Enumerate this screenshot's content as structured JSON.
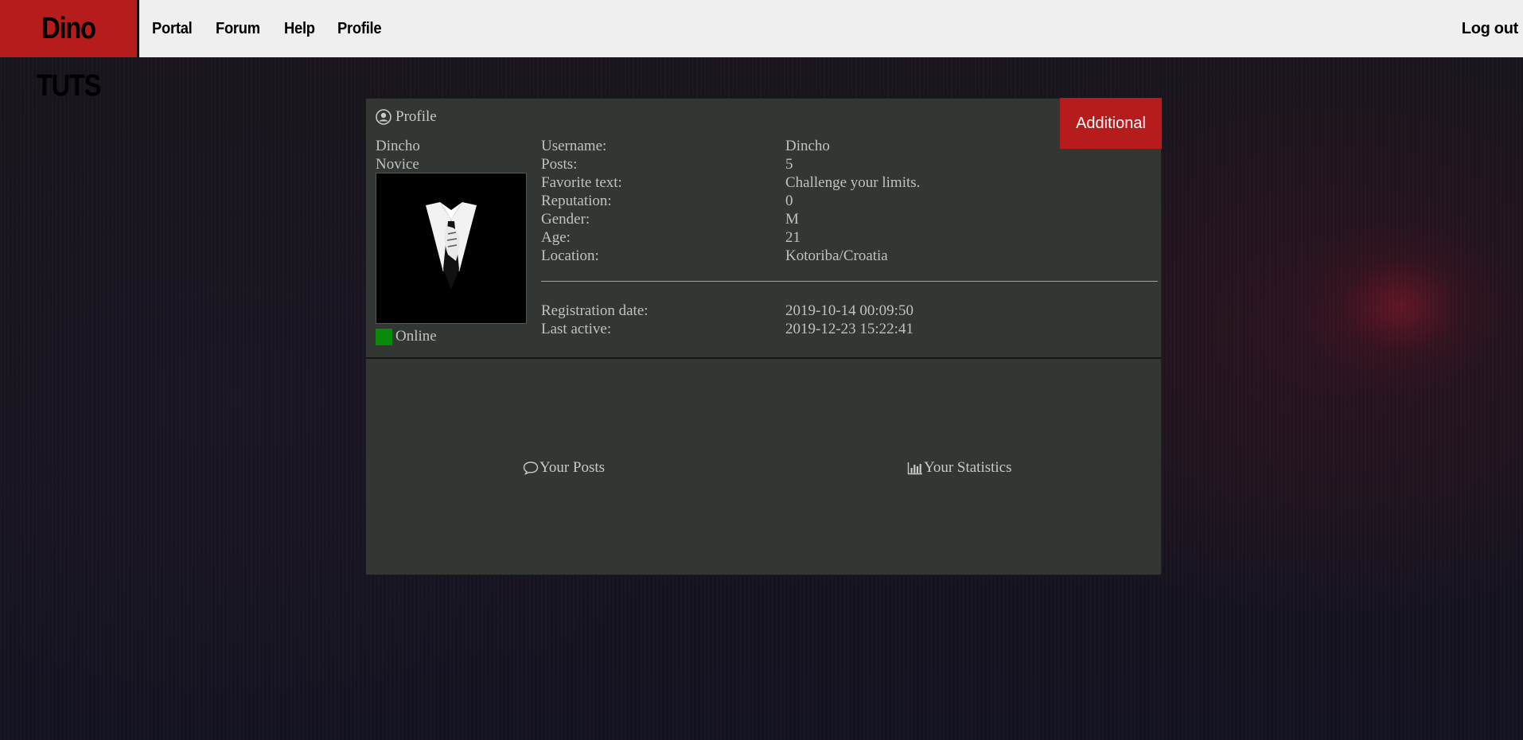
{
  "nav": {
    "brand": "Dino TUTS",
    "links": [
      "Portal",
      "Forum",
      "Help",
      "Profile"
    ],
    "logout": "Log out"
  },
  "profile": {
    "title": "Profile",
    "additional_button": "Additional",
    "username_display": "Dincho",
    "rank": "Novice",
    "status": "Online",
    "fields": [
      {
        "label": "Username:",
        "value": "Dincho"
      },
      {
        "label": "Posts:",
        "value": "5"
      },
      {
        "label": "Favorite text:",
        "value": "Challenge your limits."
      },
      {
        "label": "Reputation:",
        "value": "0"
      },
      {
        "label": "Gender:",
        "value": "M"
      },
      {
        "label": "Age:",
        "value": "21"
      },
      {
        "label": "Location:",
        "value": "Kotoriba/Croatia"
      }
    ],
    "dates": [
      {
        "label": "Registration date:",
        "value": "2019-10-14 00:09:50"
      },
      {
        "label": "Last active:",
        "value": "2019-12-23 15:22:41"
      }
    ]
  },
  "actions": {
    "posts": "Your Posts",
    "statistics": "Your Statistics"
  },
  "colors": {
    "accent": "#b71c1c",
    "panel": "#333733",
    "online": "#0a8a0a"
  }
}
